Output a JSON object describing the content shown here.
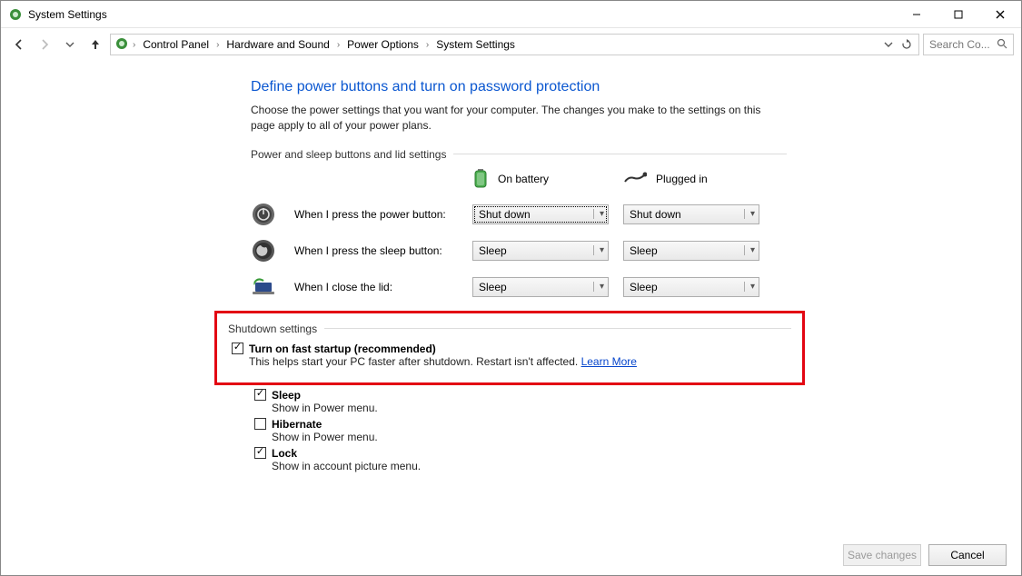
{
  "window": {
    "title": "System Settings"
  },
  "breadcrumbs": {
    "items": [
      "Control Panel",
      "Hardware and Sound",
      "Power Options",
      "System Settings"
    ]
  },
  "search": {
    "placeholder": "Search Co..."
  },
  "page": {
    "title": "Define power buttons and turn on password protection",
    "description": "Choose the power settings that you want for your computer. The changes you make to the settings on this page apply to all of your power plans."
  },
  "group_buttons": {
    "label": "Power and sleep buttons and lid settings",
    "col_battery": "On battery",
    "col_plugged": "Plugged in",
    "rows": [
      {
        "label": "When I press the power button:",
        "battery": "Shut down",
        "plugged": "Shut down"
      },
      {
        "label": "When I press the sleep button:",
        "battery": "Sleep",
        "plugged": "Sleep"
      },
      {
        "label": "When I close the lid:",
        "battery": "Sleep",
        "plugged": "Sleep"
      }
    ]
  },
  "group_shutdown": {
    "label": "Shutdown settings",
    "items": {
      "fast_startup": {
        "checked": true,
        "label": "Turn on fast startup (recommended)",
        "sub": "This helps start your PC faster after shutdown. Restart isn't affected.",
        "link": "Learn More"
      },
      "sleep": {
        "checked": true,
        "label": "Sleep",
        "sub": "Show in Power menu."
      },
      "hibernate": {
        "checked": false,
        "label": "Hibernate",
        "sub": "Show in Power menu."
      },
      "lock": {
        "checked": true,
        "label": "Lock",
        "sub": "Show in account picture menu."
      }
    }
  },
  "footer": {
    "save": "Save changes",
    "cancel": "Cancel"
  }
}
